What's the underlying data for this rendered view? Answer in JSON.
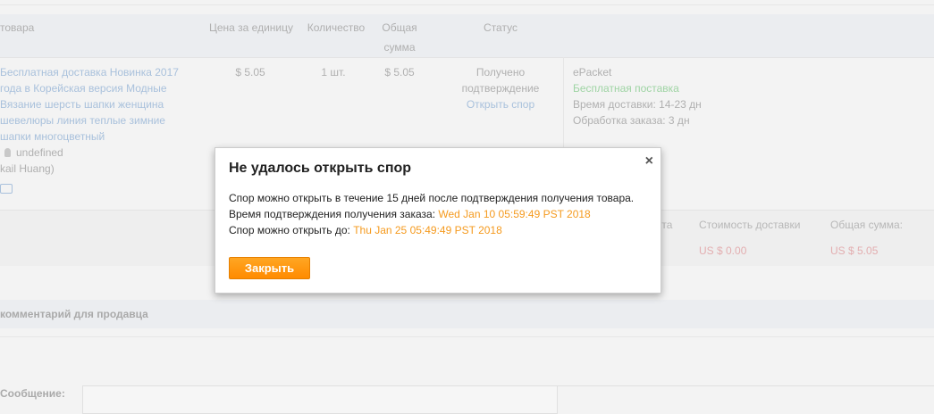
{
  "table_header": {
    "product": "товара",
    "unit_price": "Цена за единицу",
    "quantity": "Количество",
    "total_line1": "Общая",
    "total_line2": "сумма",
    "status": "Статус"
  },
  "product_row": {
    "title_lines": [
      "Бесплатная доставка Новинка 2017",
      "года в Корейская версия Модные",
      "Вязание шерсть шапки женщина",
      "шевелюры линия теплые зимние",
      "шапки многоцветный"
    ],
    "seller": "undefined",
    "seller_name": "kail Huang)",
    "unit_price": "$ 5.05",
    "quantity": "1 шт.",
    "total": "$ 5.05",
    "status_line1": "Получено",
    "status_line2": "подтверждение",
    "open_dispute": "Открыть спор",
    "shipping_method": "ePacket",
    "free_shipping": "Бесплатная поставка",
    "delivery_time": "Время доставки:  14-23 дн",
    "processing_time": "Обработка заказа:  3 дн"
  },
  "summary": {
    "product_cost_label_partial": "кта",
    "shipping_cost_label": "Стоимость доставки",
    "total_label": "Общая сумма:",
    "shipping_cost": "US $ 0.00",
    "total": "US $ 5.05"
  },
  "comment": {
    "header": "комментарий для продавца",
    "message_label": "Сообщение:"
  },
  "modal": {
    "title": "Не удалось открыть спор",
    "line1": "Спор можно открыть в течение 15 дней после подтверждения получения товара.",
    "line2_label": "Время подтверждения получения заказа: ",
    "line2_value": "Wed Jan 10 05:59:49 PST 2018",
    "line3_label": "Спор можно открыть до: ",
    "line3_value": "Thu Jan 25 05:49:49 PST 2018",
    "close_button": "Закрыть",
    "close_icon": "×"
  }
}
